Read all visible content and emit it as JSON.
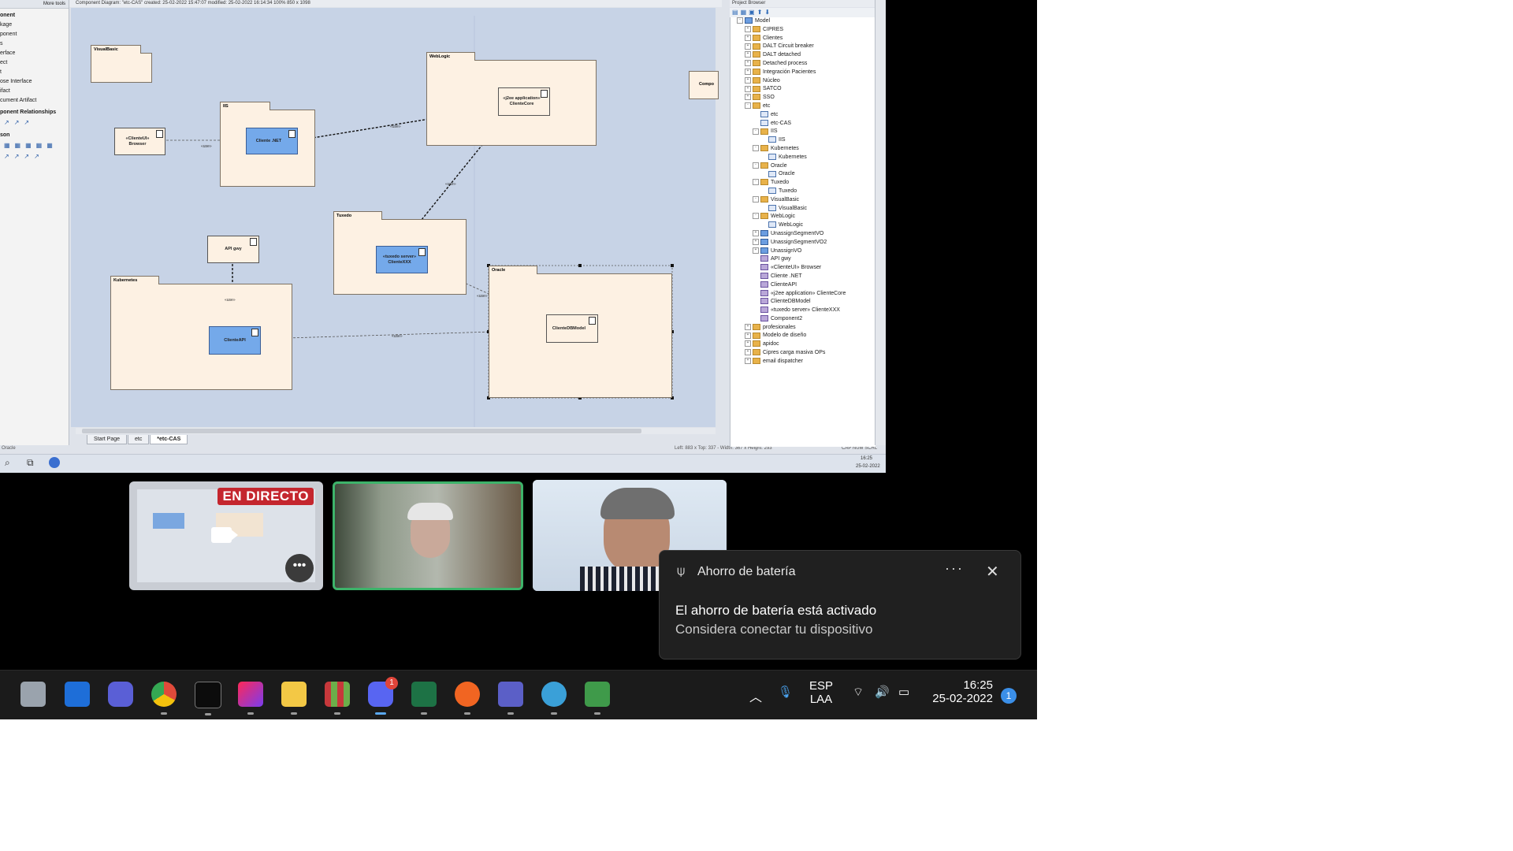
{
  "ea": {
    "diagram_title": "Component Diagram: \"etc-CAS\"  created: 25-02-2022 15:47:07  modified: 25-02-2022 16:14:34  100%  850 x 1098",
    "toolbox_header": "More tools",
    "toolbox_items": [
      "onent",
      "kage",
      "ponent",
      "s",
      "erface",
      "ect",
      "t",
      "ose Interface",
      "ifact",
      "cument Artifact"
    ],
    "toolbox_section1": "ponent Relationships",
    "toolbox_section2": "son",
    "packages": {
      "visualbasic": "VisualBasic",
      "iis": "IIS",
      "weblogic": "WebLogic",
      "tuxedo": "Tuxedo",
      "kubernetes": "Kubernetes",
      "oracle": "Oracle",
      "compo": "Compo"
    },
    "components": {
      "browser": "«ClienteUI» Browser",
      "cliente_net": "Cliente .NET",
      "clientecore": "«j2ee application» ClienteCore",
      "clientexxx": "«tuxedo server» ClienteXXX",
      "apigwy": "API gwy",
      "clienteapi": "ClienteAPI",
      "clientedbmodel": "ClienteDBModel"
    },
    "connector_label": "«use»",
    "doc_tabs": [
      "Start Page",
      "etc",
      "*etc-CAS"
    ],
    "status_left": "Oracle",
    "status_right": "Left: 883 x Top: 337 - Width: 367 x Height: 293",
    "status_caps": "CAP  NUM  SCRL",
    "clock_time": "16:25",
    "clock_date": "25-02-2022",
    "project_browser_title": "Project Browser",
    "tree": [
      {
        "label": "Model",
        "indent": 0,
        "icon": "model",
        "ex": "-"
      },
      {
        "label": "CIPRES",
        "indent": 1,
        "icon": "folder",
        "ex": "+"
      },
      {
        "label": "Clientes",
        "indent": 1,
        "icon": "folder",
        "ex": "+"
      },
      {
        "label": "DALT Circuit breaker",
        "indent": 1,
        "icon": "folder",
        "ex": "+"
      },
      {
        "label": "DALT detached",
        "indent": 1,
        "icon": "folder",
        "ex": "+"
      },
      {
        "label": "Detached process",
        "indent": 1,
        "icon": "folder",
        "ex": "+"
      },
      {
        "label": "Integración Pacientes",
        "indent": 1,
        "icon": "folder",
        "ex": "+"
      },
      {
        "label": "Núcleo",
        "indent": 1,
        "icon": "folder",
        "ex": "+"
      },
      {
        "label": "SATCO",
        "indent": 1,
        "icon": "folder",
        "ex": "+"
      },
      {
        "label": "SSO",
        "indent": 1,
        "icon": "folder",
        "ex": "+"
      },
      {
        "label": "etc",
        "indent": 1,
        "icon": "folder",
        "ex": "-"
      },
      {
        "label": "etc",
        "indent": 2,
        "icon": "diag",
        "ex": ""
      },
      {
        "label": "etc-CAS",
        "indent": 2,
        "icon": "diag",
        "ex": ""
      },
      {
        "label": "IIS",
        "indent": 2,
        "icon": "folder",
        "ex": "-"
      },
      {
        "label": "IIS",
        "indent": 3,
        "icon": "diag",
        "ex": ""
      },
      {
        "label": "Kubernetes",
        "indent": 2,
        "icon": "folder",
        "ex": "-"
      },
      {
        "label": "Kubernetes",
        "indent": 3,
        "icon": "diag",
        "ex": ""
      },
      {
        "label": "Oracle",
        "indent": 2,
        "icon": "folder",
        "ex": "-"
      },
      {
        "label": "Oracle",
        "indent": 3,
        "icon": "diag",
        "ex": ""
      },
      {
        "label": "Tuxedo",
        "indent": 2,
        "icon": "folder",
        "ex": "-"
      },
      {
        "label": "Tuxedo",
        "indent": 3,
        "icon": "diag",
        "ex": ""
      },
      {
        "label": "VisualBasic",
        "indent": 2,
        "icon": "folder",
        "ex": "-"
      },
      {
        "label": "VisualBasic",
        "indent": 3,
        "icon": "diag",
        "ex": ""
      },
      {
        "label": "WebLogic",
        "indent": 2,
        "icon": "folder",
        "ex": "-"
      },
      {
        "label": "WebLogic",
        "indent": 3,
        "icon": "diag",
        "ex": ""
      },
      {
        "label": "UnassignSegmentVO",
        "indent": 2,
        "icon": "model",
        "ex": "+"
      },
      {
        "label": "UnassignSegmentVO2",
        "indent": 2,
        "icon": "model",
        "ex": "+"
      },
      {
        "label": "UnassignVO",
        "indent": 2,
        "icon": "model",
        "ex": "+"
      },
      {
        "label": "API gwy",
        "indent": 2,
        "icon": "comp",
        "ex": ""
      },
      {
        "label": "«ClienteUI» Browser",
        "indent": 2,
        "icon": "comp",
        "ex": ""
      },
      {
        "label": "Cliente .NET",
        "indent": 2,
        "icon": "comp",
        "ex": ""
      },
      {
        "label": "ClienteAPI",
        "indent": 2,
        "icon": "comp",
        "ex": ""
      },
      {
        "label": "«j2ee application» ClienteCore",
        "indent": 2,
        "icon": "comp",
        "ex": ""
      },
      {
        "label": "ClienteDBModel",
        "indent": 2,
        "icon": "comp",
        "ex": ""
      },
      {
        "label": "«tuxedo server» ClienteXXX",
        "indent": 2,
        "icon": "comp",
        "ex": ""
      },
      {
        "label": "Component2",
        "indent": 2,
        "icon": "comp",
        "ex": ""
      },
      {
        "label": "profesionales",
        "indent": 1,
        "icon": "folder",
        "ex": "+"
      },
      {
        "label": "Modelo de diseño",
        "indent": 1,
        "icon": "folder",
        "ex": "+"
      },
      {
        "label": "apidoc",
        "indent": 1,
        "icon": "folder",
        "ex": "+"
      },
      {
        "label": "Cipres carga masiva OPs",
        "indent": 1,
        "icon": "folder",
        "ex": "+"
      },
      {
        "label": "email dispatcher",
        "indent": 1,
        "icon": "folder",
        "ex": "+"
      }
    ]
  },
  "meeting": {
    "live_badge": "EN DIRECTO",
    "more_glyph": "•••"
  },
  "notification": {
    "app_name": "Ahorro de batería",
    "more_glyph": "···",
    "close_glyph": "✕",
    "title": "El ahorro de batería está activado",
    "body": "Considera conectar tu dispositivo"
  },
  "taskbar": {
    "lang_line1": "ESP",
    "lang_line2": "LAA",
    "time": "16:25",
    "date": "25-02-2022",
    "discord_badge": "1",
    "notif_badge": "1"
  }
}
